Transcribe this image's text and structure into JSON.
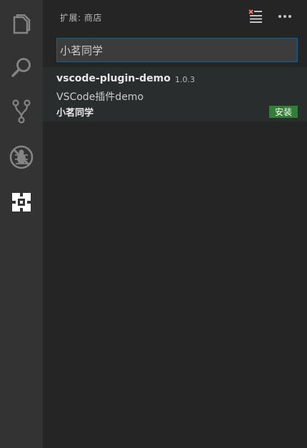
{
  "sidebar": {
    "title": "扩展: 商店",
    "search": {
      "value": "小茗同学",
      "placeholder": ""
    },
    "extensions": [
      {
        "name": "vscode-plugin-demo",
        "version": "1.0.3",
        "description": "VSCode插件demo",
        "publisher": "小茗同学",
        "install_label": "安装"
      }
    ]
  },
  "activity_bar": {
    "icons": [
      "files-icon",
      "search-icon",
      "source-control-icon",
      "debug-icon",
      "extensions-icon"
    ]
  },
  "header": {
    "icons": [
      "clear-extensions-icon",
      "more-actions-icon"
    ]
  },
  "colors": {
    "activity_bar_bg": "#333333",
    "sidebar_bg": "#252526",
    "install_button": "#327e36",
    "focus_border": "#0e639c"
  }
}
